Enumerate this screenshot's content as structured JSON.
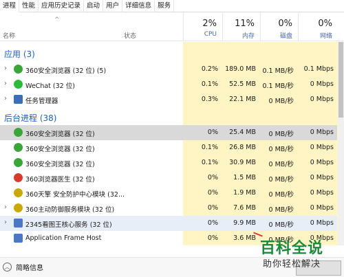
{
  "tabs": [
    "进程",
    "性能",
    "应用历史记录",
    "启动",
    "用户",
    "详细信息",
    "服务"
  ],
  "header": {
    "name_label": "名称",
    "status_label": "状态",
    "cpu": {
      "pct": "2%",
      "label": "CPU"
    },
    "mem": {
      "pct": "11%",
      "label": "内存"
    },
    "disk": {
      "pct": "0%",
      "label": "磁盘"
    },
    "net": {
      "pct": "0%",
      "label": "网络"
    }
  },
  "groups": {
    "apps": "应用 (3)",
    "background": "后台进程 (38)"
  },
  "rows": [
    {
      "name": "360安全浏览器 (32 位) (5)",
      "cpu": "0.2%",
      "mem": "189.0 MB",
      "disk": "0.1 MB/秒",
      "net": "0.1 Mbps",
      "icon": "360-browser-icon",
      "expand": true
    },
    {
      "name": "WeChat (32 位)",
      "cpu": "0.1%",
      "mem": "52.5 MB",
      "disk": "0.1 MB/秒",
      "net": "0 Mbps",
      "icon": "wechat-icon",
      "expand": true
    },
    {
      "name": "任务管理器",
      "cpu": "0.3%",
      "mem": "22.1 MB",
      "disk": "0 MB/秒",
      "net": "0 Mbps",
      "icon": "task-manager-icon",
      "expand": true
    },
    {
      "name": "360安全浏览器 (32 位)",
      "cpu": "0%",
      "mem": "25.4 MB",
      "disk": "0 MB/秒",
      "net": "0 Mbps",
      "icon": "360-browser-icon",
      "expand": false
    },
    {
      "name": "360安全浏览器 (32 位)",
      "cpu": "0.1%",
      "mem": "26.8 MB",
      "disk": "0 MB/秒",
      "net": "0 Mbps",
      "icon": "360-browser-icon",
      "expand": false
    },
    {
      "name": "360安全浏览器 (32 位)",
      "cpu": "0.1%",
      "mem": "30.9 MB",
      "disk": "0 MB/秒",
      "net": "0 Mbps",
      "icon": "360-browser-icon",
      "expand": false
    },
    {
      "name": "360浏览器医生 (32 位)",
      "cpu": "0%",
      "mem": "1.5 MB",
      "disk": "0 MB/秒",
      "net": "0 Mbps",
      "icon": "browser-doctor-icon",
      "expand": false
    },
    {
      "name": "360天擎 安全防护中心模块 (32...",
      "cpu": "0%",
      "mem": "1.9 MB",
      "disk": "0 MB/秒",
      "net": "0 Mbps",
      "icon": "shield-icon",
      "expand": false
    },
    {
      "name": "360主动防御服务模块 (32 位)",
      "cpu": "0%",
      "mem": "7.6 MB",
      "disk": "0 MB/秒",
      "net": "0 Mbps",
      "icon": "shield-icon",
      "expand": true
    },
    {
      "name": "2345看图王核心服务 (32 位)",
      "cpu": "0%",
      "mem": "9.9 MB",
      "disk": "0 MB/秒",
      "net": "0 Mbps",
      "icon": "app-window-icon",
      "expand": true
    },
    {
      "name": "Application Frame Host",
      "cpu": "0%",
      "mem": "3.6 MB",
      "disk": "0 MB/秒",
      "net": "0 Mbps",
      "icon": "app-window-icon",
      "expand": false
    }
  ],
  "footer": {
    "summary": "简略信息"
  },
  "watermark": {
    "title": "百科全说",
    "subtitle": "助你轻松解决"
  },
  "colors": {
    "heat": "#fff4c4",
    "selected": "#d9d9d9",
    "group_text": "#1f5fb8",
    "accent_green": "#1c8a3a"
  }
}
